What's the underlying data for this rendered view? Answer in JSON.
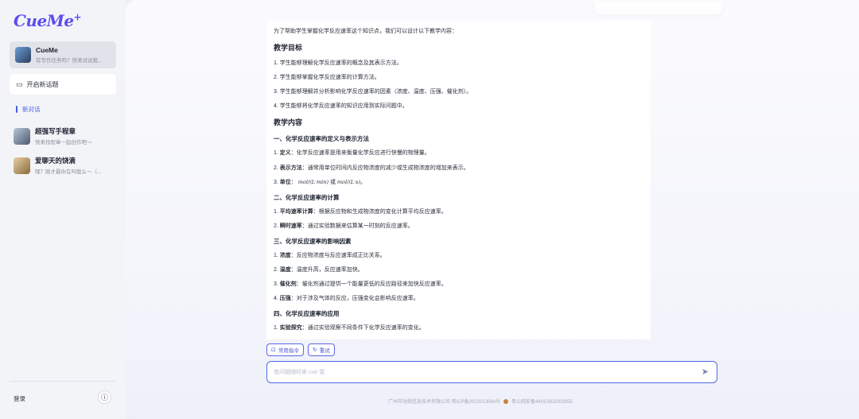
{
  "sidebar": {
    "logo": "CueMe",
    "logo_plus": "+",
    "agent": {
      "title": "CueMe",
      "subtitle": "有写作任务吗？快来试试我..."
    },
    "new_topic_label": "开启新话题",
    "new_chat_label": "新对话",
    "history": [
      {
        "title": "超强写手程章",
        "subtitle": "快来找程章一起创作吧～"
      },
      {
        "title": "爱聊天的饶滴",
        "subtitle": "嘿？刚才最你在叫我么～（..."
      }
    ],
    "login_label": "登录",
    "info_icon": "ⓘ"
  },
  "message": {
    "intro": "为了帮助学生掌握化学反应速率这个知识点，我们可以设计以下教学内容：",
    "h_goal": "教学目标",
    "goals": [
      "1. 学生能够理解化学反应速率的概念及其表示方法。",
      "2. 学生能够掌握化学反应速率的计算方法。",
      "3. 学生能够理解并分析影响化学反应速率的因素（浓度、温度、压强、催化剂）。",
      "4. 学生能够将化学反应速率的知识应用到实际问题中。"
    ],
    "h_content": "教学内容",
    "s1_title": "一、化学反应速率的定义与表示方法",
    "s1_items": [
      {
        "num": "1.",
        "key": "定义",
        "text": "：化学反应速率是用来衡量化学反应进行快慢的物理量。"
      },
      {
        "num": "2.",
        "key": "表示方法",
        "text": "：通常用单位时间内反应物浓度的减少或生成物浓度的增加来表示。"
      }
    ],
    "s1_unit_num": "3.",
    "s1_unit_key": "单位",
    "s1_unit_colon": "：",
    "s1_unit_math1": "mol/(L·min)",
    "s1_unit_or": "或",
    "s1_unit_math2": "mol/(L·s)",
    "s1_unit_end": "。",
    "s2_title": "二、化学反应速率的计算",
    "s2_items": [
      {
        "num": "1.",
        "key": "平均速率计算",
        "text": "：根据反应物和生成物浓度的变化计算平均反应速率。"
      },
      {
        "num": "2.",
        "key": "瞬时速率",
        "text": "：通过实验数据来估算某一时刻的反应速率。"
      }
    ],
    "s3_title": "三、化学反应速率的影响因素",
    "s3_items": [
      {
        "num": "1.",
        "key": "浓度",
        "text": "：反应物浓度与反应速率成正比关系。"
      },
      {
        "num": "2.",
        "key": "温度",
        "text": "：温度升高，反应速率加快。"
      },
      {
        "num": "3.",
        "key": "催化剂",
        "text": "：催化剂通过提供一个能量更低的反应路径来加快反应速率。"
      },
      {
        "num": "4.",
        "key": "压强",
        "text": "：对于涉及气体的反应，压强变化会影响反应速率。"
      }
    ],
    "s4_title": "四、化学反应速率的应用",
    "s4_items": [
      {
        "num": "1.",
        "key": "实验探究",
        "text": "：通过实验观察不同条件下化学反应速率的变化。"
      }
    ]
  },
  "chips": {
    "commands": "常用指令",
    "retry": "重试"
  },
  "input": {
    "placeholder": "有问题随时来 cue 我",
    "value": ""
  },
  "footer": {
    "company": "广州市动视信息技术有限公司 粤ICP备2022013084号",
    "police": "粤公网安备44010502003055"
  },
  "colors": {
    "accent": "#5468e8",
    "sidebar_bg": "#f3f4f8",
    "logo": "#5b4cf0"
  }
}
